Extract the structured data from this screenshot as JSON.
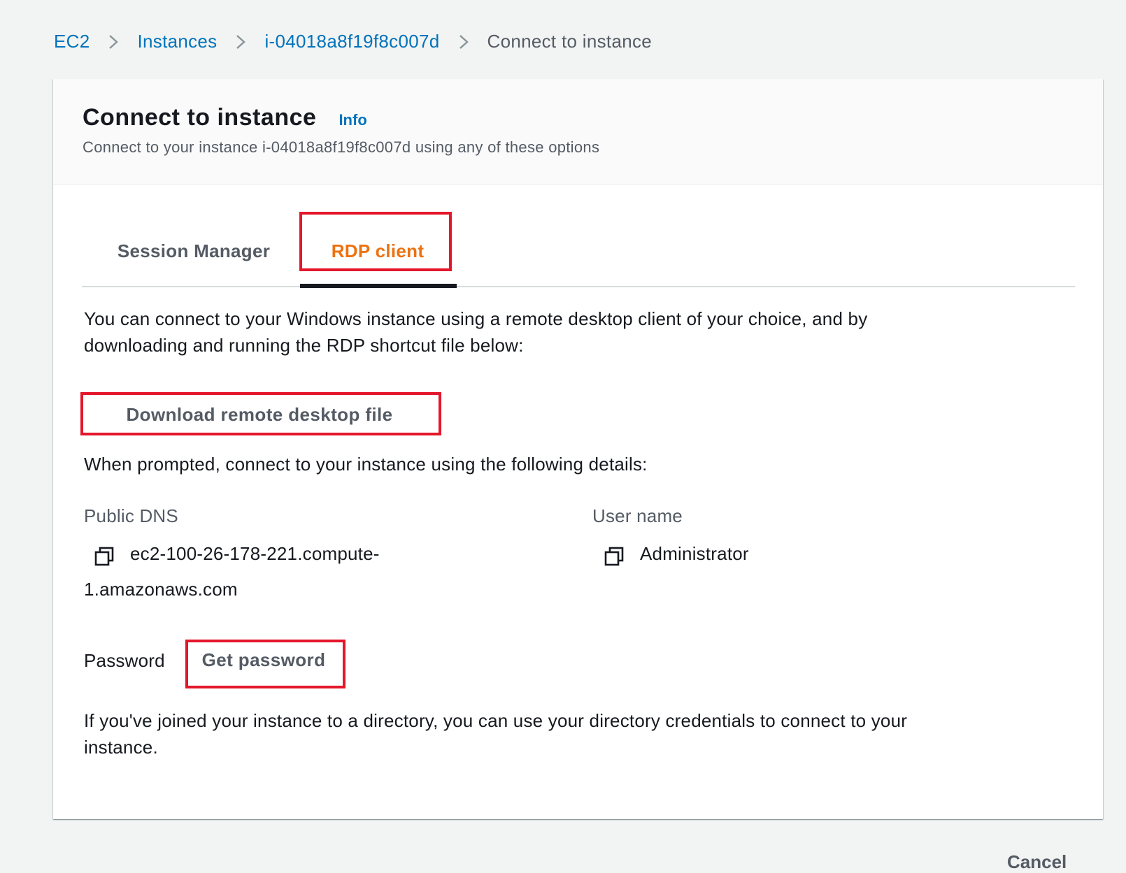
{
  "breadcrumb": {
    "items": [
      "EC2",
      "Instances",
      "i-04018a8f19f8c007d"
    ],
    "current": "Connect to instance"
  },
  "header": {
    "title": "Connect to instance",
    "info": "Info",
    "subtitle": "Connect to your instance i-04018a8f19f8c007d using any of these options"
  },
  "tabs": {
    "items": [
      "Session Manager",
      "RDP client"
    ],
    "active": "RDP client"
  },
  "rdp": {
    "intro_line1": "You can connect to your Windows instance using a remote desktop client of your choice, and by",
    "intro_line2": "downloading and running the RDP shortcut file below:",
    "download_button": "Download remote desktop file",
    "prompt_text": "When prompted, connect to your instance using the following details:",
    "public_dns_label": "Public DNS",
    "public_dns_line1": "ec2-100-26-178-221.compute-",
    "public_dns_line2": "1.amazonaws.com",
    "user_name_label": "User name",
    "user_name_value": "Administrator",
    "password_label": "Password",
    "get_password_button": "Get password",
    "directory_line1": "If you've joined your instance to a directory, you can use your directory credentials to connect to your",
    "directory_line2": "instance."
  },
  "footer": {
    "cancel_button_partial": "Cancel"
  },
  "colors": {
    "link": "#0073bb",
    "active_tab": "#ec7211",
    "highlight_box": "#e4172b",
    "page_background": "#f2f3f3"
  },
  "icons": [
    "chevron-right-icon",
    "copy-icon"
  ]
}
